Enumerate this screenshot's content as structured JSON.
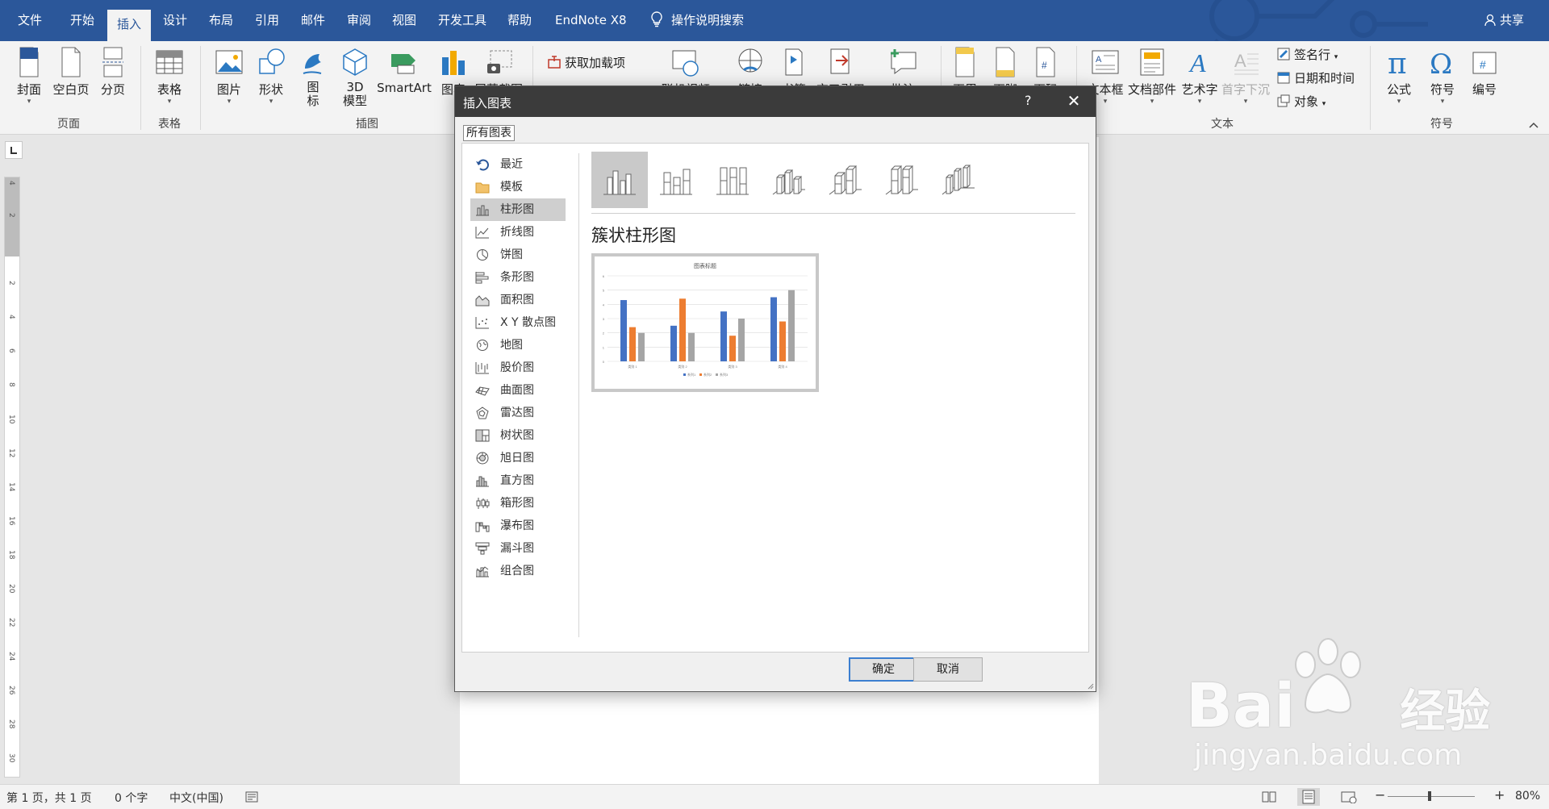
{
  "menubar": {
    "tabs": [
      "文件",
      "开始",
      "插入",
      "设计",
      "布局",
      "引用",
      "邮件",
      "审阅",
      "视图",
      "开发工具",
      "帮助",
      "EndNote X8"
    ],
    "active_tab": "插入",
    "search_text": "操作说明搜索",
    "share": "共享",
    "colors": {
      "bar": "#2b579a",
      "ribbon": "#f3f3f3"
    }
  },
  "ribbon": {
    "buttons": [
      "封面",
      "空白页",
      "分页",
      "表格",
      "图片",
      "形状",
      "图标",
      "3D 模型",
      "SmartArt",
      "图表",
      "屏幕截图",
      "获取加载项",
      "联机视频",
      "链接",
      "书签",
      "交叉引用",
      "批注",
      "页眉",
      "页脚",
      "页码",
      "文本框",
      "文档部件",
      "艺术字",
      "首字下沉",
      "签名行",
      "日期和时间",
      "对象",
      "公式",
      "符号",
      "编号"
    ],
    "groups": [
      "页面",
      "表格",
      "插图",
      "文本",
      "符号"
    ]
  },
  "dialog": {
    "title": "插入图表",
    "help": "?",
    "tab": "所有图表",
    "chart_types": [
      "最近",
      "模板",
      "柱形图",
      "折线图",
      "饼图",
      "条形图",
      "面积图",
      "X Y 散点图",
      "地图",
      "股价图",
      "曲面图",
      "雷达图",
      "树状图",
      "旭日图",
      "直方图",
      "箱形图",
      "瀑布图",
      "漏斗图",
      "组合图"
    ],
    "selected_type": "柱形图",
    "subtype_name": "簇状柱形图",
    "ok": "确定",
    "cancel": "取消"
  },
  "chart_data": {
    "type": "bar",
    "title": "图表标题",
    "categories": [
      "类别 1",
      "类别 2",
      "类别 3",
      "类别 4"
    ],
    "series": [
      {
        "name": "系列1",
        "values": [
          4.3,
          2.5,
          3.5,
          4.5
        ],
        "color": "#4472c4"
      },
      {
        "name": "系列2",
        "values": [
          2.4,
          4.4,
          1.8,
          2.8
        ],
        "color": "#ed7d31"
      },
      {
        "name": "系列3",
        "values": [
          2,
          2,
          3,
          5
        ],
        "color": "#a5a5a5"
      }
    ],
    "ylim": [
      0,
      6
    ],
    "yticks": [
      "0",
      "1",
      "2",
      "3",
      "4",
      "5",
      "6"
    ],
    "legend_position": "bottom",
    "grid": true
  },
  "statusbar": {
    "page": "第 1 页，共 1 页",
    "words": "0 个字",
    "language": "中文(中国)",
    "zoom": "80%",
    "zoom_minus": "−",
    "zoom_plus": "+"
  },
  "ruler_numbers": [
    "4",
    "2",
    "2",
    "4",
    "6",
    "8",
    "10",
    "12",
    "14",
    "16",
    "18",
    "20",
    "22",
    "24",
    "26",
    "28",
    "30"
  ],
  "watermark": {
    "brand": "Bai",
    "brand_cn": "经验",
    "url": "jingyan.baidu.com"
  }
}
